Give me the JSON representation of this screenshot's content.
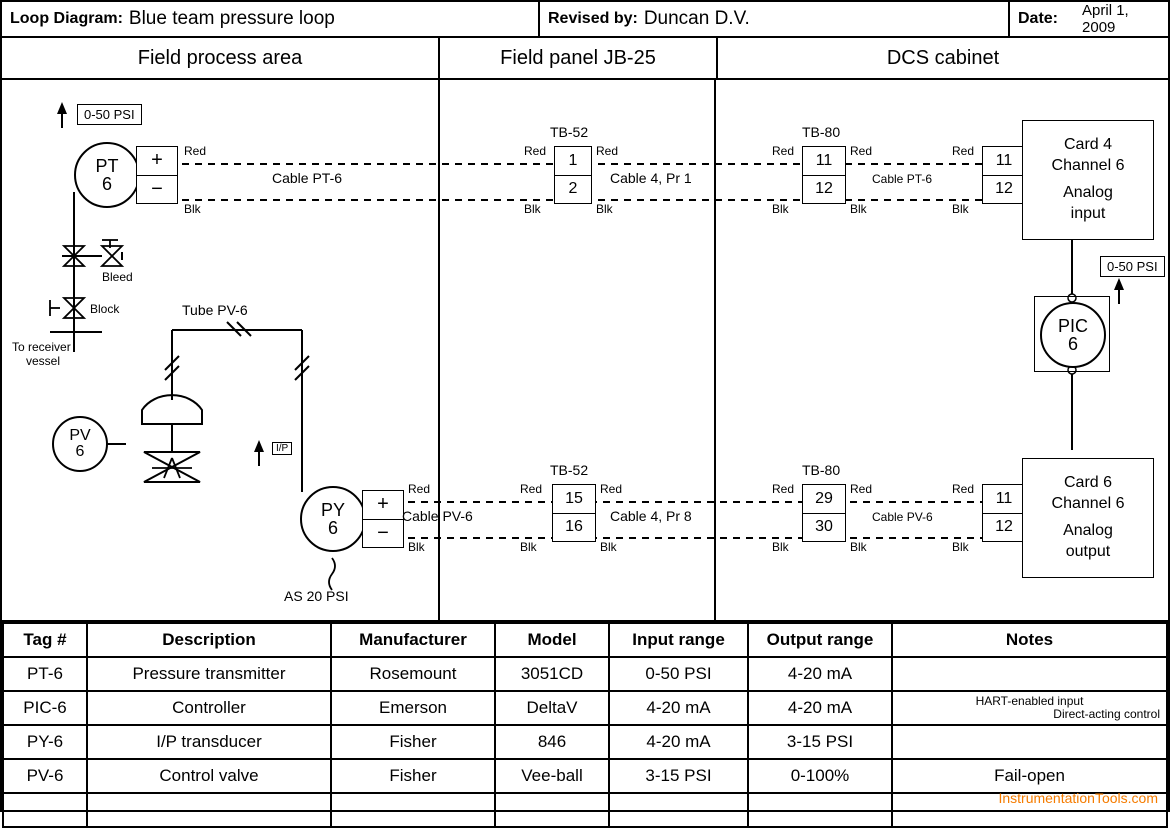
{
  "header": {
    "loop_label": "Loop Diagram:",
    "loop_value": "Blue team pressure loop",
    "rev_label": "Revised by:",
    "rev_value": "Duncan D.V.",
    "date_label": "Date:",
    "date_value": "April 1, 2009"
  },
  "columns": {
    "c1": "Field process area",
    "c2": "Field panel JB-25",
    "c3": "DCS cabinet"
  },
  "diagram": {
    "range_top": "0-50 PSI",
    "range_pic": "0-50 PSI",
    "pt": {
      "tag1": "PT",
      "tag2": "6"
    },
    "py": {
      "tag1": "PY",
      "tag2": "6"
    },
    "pv": {
      "tag1": "PV",
      "tag2": "6"
    },
    "pic": {
      "tag1": "PIC",
      "tag2": "6"
    },
    "pm_plus": "+",
    "pm_minus": "−",
    "wires": {
      "red": "Red",
      "blk": "Blk"
    },
    "cable_pt6": "Cable PT-6",
    "cable_pv6": "Cable PV-6",
    "cable4_pr1": "Cable 4, Pr 1",
    "cable4_pr8": "Cable 4, Pr 8",
    "cable_pt6_b": "Cable PT-6",
    "cable_pv6_b": "Cable PV-6",
    "tb52": "TB-52",
    "tb80": "TB-80",
    "tb52a": {
      "t": "1",
      "b": "2"
    },
    "tb52b": {
      "t": "15",
      "b": "16"
    },
    "tb80a": {
      "t": "11",
      "b": "12"
    },
    "tb80b": {
      "t": "29",
      "b": "30"
    },
    "card_in_tb": {
      "t": "11",
      "b": "12"
    },
    "card_out_tb": {
      "t": "11",
      "b": "12"
    },
    "card_in": {
      "l1": "Card 4",
      "l2": "Channel 6",
      "l3": "Analog",
      "l4": "input"
    },
    "card_out": {
      "l1": "Card 6",
      "l2": "Channel 6",
      "l3": "Analog",
      "l4": "output"
    },
    "bleed": "Bleed",
    "block": "Block",
    "to_recv1": "To receiver",
    "to_recv2": "vessel",
    "tube_pv6": "Tube PV-6",
    "ip": "I/P",
    "as20": "AS 20 PSI"
  },
  "table": {
    "headers": [
      "Tag #",
      "Description",
      "Manufacturer",
      "Model",
      "Input range",
      "Output range",
      "Notes"
    ],
    "rows": [
      {
        "tag": "PT-6",
        "desc": "Pressure transmitter",
        "man": "Rosemount",
        "model": "3051CD",
        "in": "0-50 PSI",
        "out": "4-20 mA",
        "notes": ""
      },
      {
        "tag": "PIC-6",
        "desc": "Controller",
        "man": "Emerson",
        "model": "DeltaV",
        "in": "4-20 mA",
        "out": "4-20 mA",
        "notes": "HART-enabled input\nDirect-acting control"
      },
      {
        "tag": "PY-6",
        "desc": "I/P transducer",
        "man": "Fisher",
        "model": "846",
        "in": "4-20 mA",
        "out": "3-15 PSI",
        "notes": ""
      },
      {
        "tag": "PV-6",
        "desc": "Control valve",
        "man": "Fisher",
        "model": "Vee-ball",
        "in": "3-15 PSI",
        "out": "0-100%",
        "notes": "Fail-open"
      },
      {
        "tag": "",
        "desc": "",
        "man": "",
        "model": "",
        "in": "",
        "out": "",
        "notes": ""
      }
    ]
  },
  "watermark": "InstrumentationTools.com"
}
